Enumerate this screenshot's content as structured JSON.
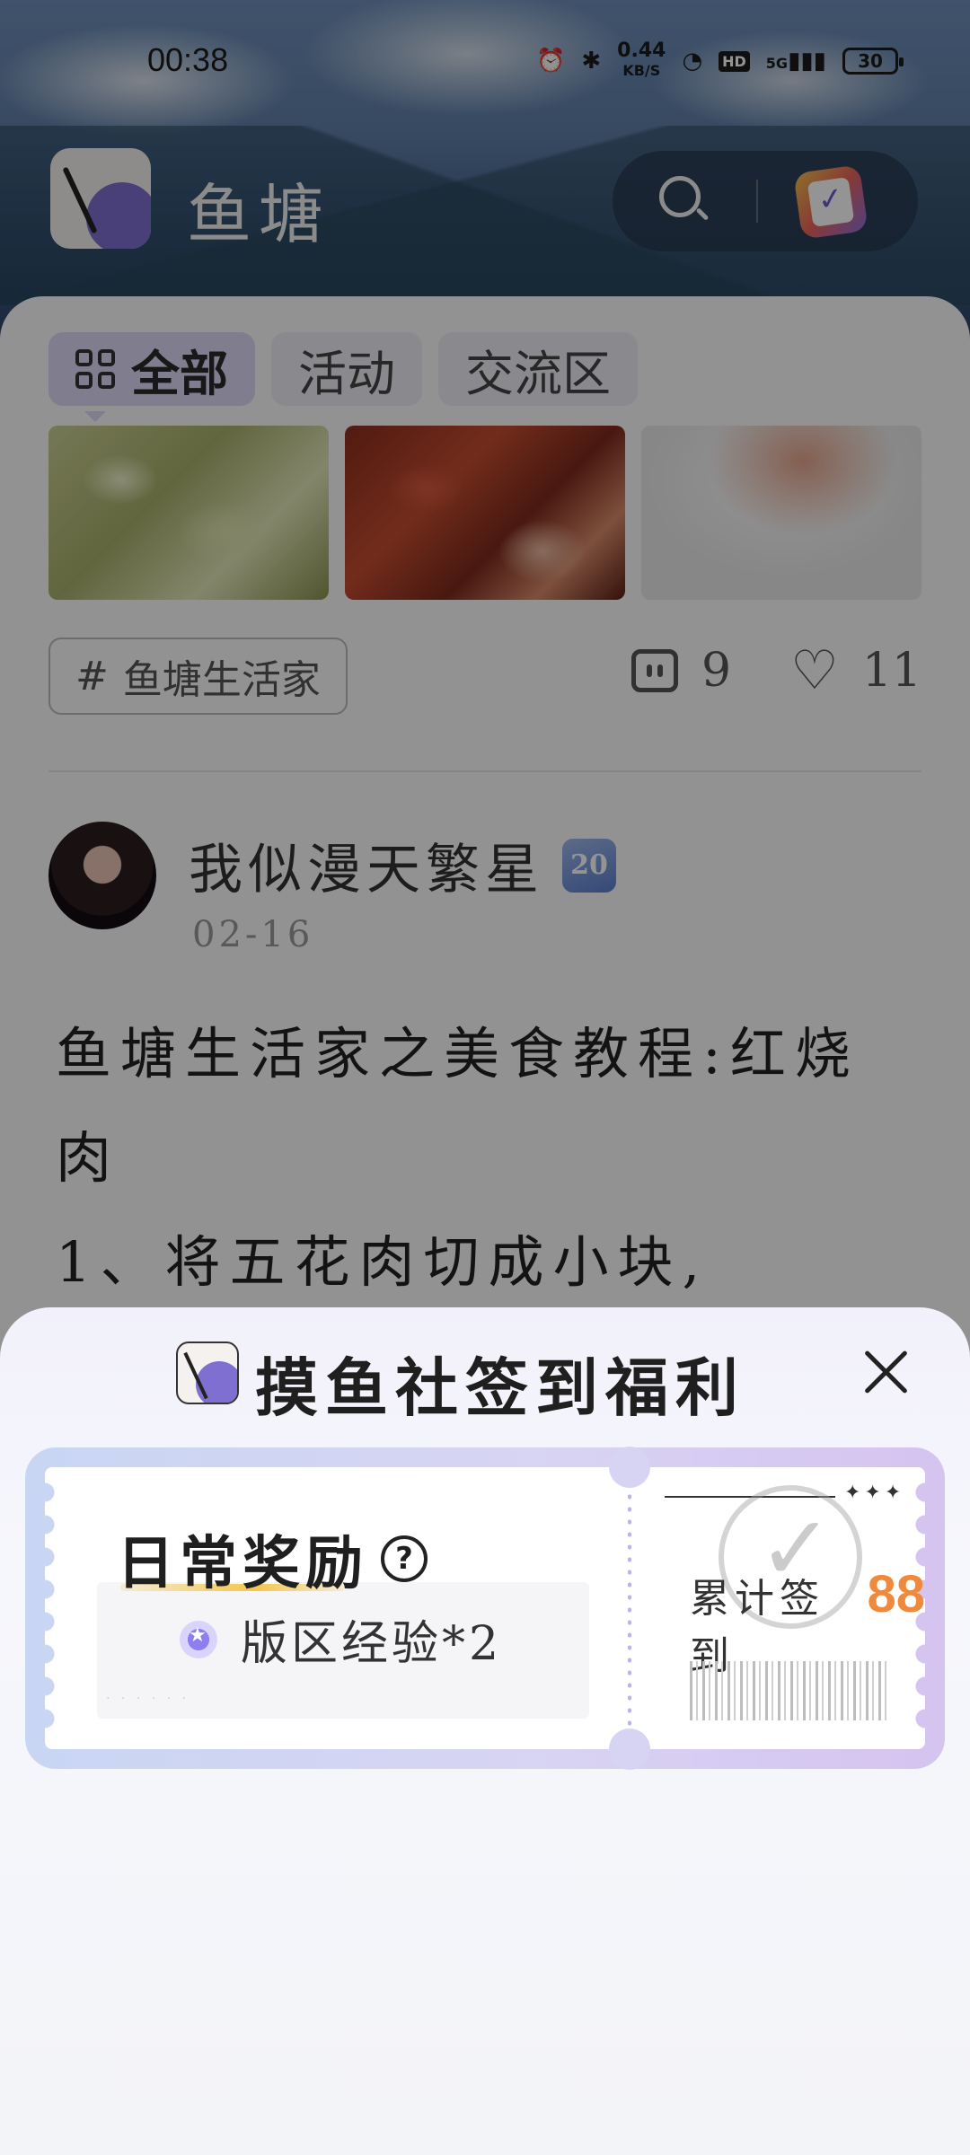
{
  "status_bar": {
    "time": "00:38",
    "net_speed": "0.44",
    "net_unit": "KB/S",
    "hd": "HD",
    "signal": "5G",
    "battery": "30"
  },
  "header": {
    "app_name": "鱼塘"
  },
  "feed": {
    "tabs": [
      {
        "label": "全部",
        "active": true
      },
      {
        "label": "活动",
        "active": false
      },
      {
        "label": "交流区",
        "active": false
      }
    ],
    "post": {
      "topic": "鱼塘生活家",
      "comments": "9",
      "likes": "11",
      "author": "我似漫天繁星",
      "level": "20",
      "date": "02-16",
      "body_line1": "鱼塘生活家之美食教程:红烧肉",
      "body_line2": "1、将五花肉切成小块,"
    }
  },
  "sheet": {
    "title": "摸鱼社签到福利",
    "reward_title": "日常奖励",
    "reward_item": "版区经验*2",
    "total_label": "累计签到",
    "total_count": "88"
  },
  "colors": {
    "accent": "#ef8a3c",
    "brand_purple": "#7e6fd0",
    "tab_active_bg": "#ddd8f7"
  }
}
